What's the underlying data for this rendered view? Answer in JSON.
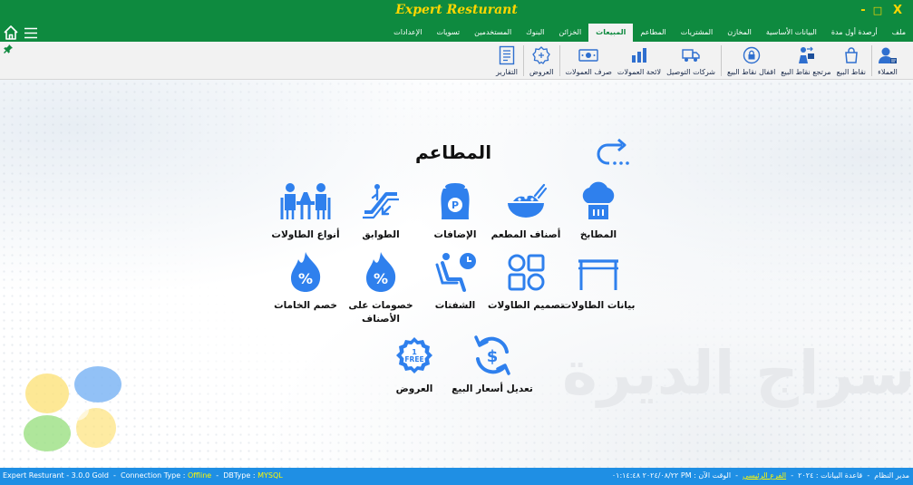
{
  "window": {
    "title": "Expert Resturant",
    "minimize": "-",
    "maximize": "□",
    "close": "X"
  },
  "menu": {
    "items": [
      "ملف",
      "أرصدة أول مدة",
      "البيانات الأساسية",
      "المخازن",
      "المشتريات",
      "المطاعم",
      "المبيعات",
      "الخزائن",
      "البنوك",
      "المستخدمين",
      "تسويات",
      "الإعدادات"
    ],
    "active_index": 6
  },
  "toolbar": {
    "items": [
      "العملاء",
      "نقاط البيع",
      "مرتجع نقاط البيع",
      "اقفال نقاط البيع",
      "شركات التوصيل",
      "لائحة العمولات",
      "صرف العمولات",
      "العروض",
      "التقارير"
    ]
  },
  "page": {
    "title": "المطاعم",
    "tiles": [
      "المطابخ",
      "أصناف المطعم",
      "الإضافات",
      "الطوابق",
      "أنواع الطاولات",
      "بيانات الطاولات",
      "تصميم الطاولات",
      "الشفتات",
      "خصومات على الأصناف",
      "خصم الخامات",
      "تعديل أسعار البيع",
      "العروض"
    ],
    "offer_badge_top": "1",
    "offer_badge_text": "FREE"
  },
  "status": {
    "app": "Expert Resturant - 3.0.0 Gold",
    "connection_label": "Connection Type :",
    "connection_value": "Offline",
    "dbtype_label": "DBType :",
    "dbtype_value": "MYSQL",
    "user": "مدير النظام",
    "db_label": "قاعدة البيانات :",
    "db_value": "٢٠٢٤",
    "branch": "الفرع الرئيسي",
    "time_label": "الوقت الآن :",
    "time_value": "٢٠٢٤/٠٨/٢٢ ٠١:١٤:٤٨ PM"
  },
  "colors": {
    "titlebar": "#0e8a3f",
    "title_text": "#ffd600",
    "icon_blue": "#2f80ed",
    "statusbar": "#1f8fe4"
  },
  "icons": {
    "home": "home-icon",
    "menu": "hamburger-icon",
    "back": "return-arrow-icon"
  }
}
